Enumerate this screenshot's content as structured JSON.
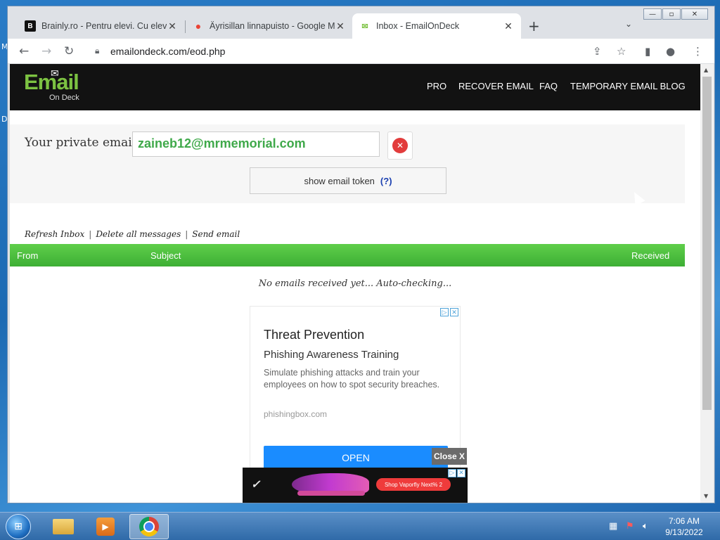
{
  "desktop": {
    "edge_letters": [
      "M",
      "D"
    ]
  },
  "browser": {
    "tabs": [
      {
        "favicon": "brainly-icon",
        "title": "Brainly.ro - Pentru elevi. Cu elevi.",
        "active": false
      },
      {
        "favicon": "maps-pin-icon",
        "title": "Äyrisillan linnapuisto - Google Maps",
        "active": false
      },
      {
        "favicon": "emailondeck-icon",
        "title": "Inbox - EmailOnDeck",
        "active": true
      }
    ],
    "url": "emailondeck.com/eod.php"
  },
  "site": {
    "logo_big": "Email",
    "logo_small": "On Deck",
    "nav": [
      "PRO",
      "RECOVER EMAIL",
      "FAQ",
      "TEMPORARY EMAIL BLOG"
    ],
    "email_label": "Your private email",
    "email_value": "zaineb12@mrmemorial.com",
    "token_label": "show email token",
    "token_help": "(?)",
    "actions": [
      "Refresh Inbox",
      "Delete all messages",
      "Send email"
    ],
    "inbox_columns": {
      "from": "From",
      "subject": "Subject",
      "received": "Received"
    },
    "empty_message": "No emails received yet... Auto-checking..."
  },
  "ad": {
    "title": "Threat Prevention",
    "subtitle": "Phishing Awareness Training",
    "description": "Simulate phishing attacks and train your employees on how to spot security breaches.",
    "domain": "phishingbox.com",
    "cta": "OPEN",
    "close_label": "Close X"
  },
  "banner_ad": {
    "cta": "Shop Vaporfly Next% 2"
  },
  "taskbar": {
    "time": "7:06 AM",
    "date": "9/13/2022"
  },
  "colors": {
    "brand_green": "#7cc242",
    "inbox_header_green": "#4cbe3e",
    "email_text_green": "#3fa94a",
    "delete_red": "#e23c3c",
    "ad_button_blue": "#1a8cff"
  }
}
